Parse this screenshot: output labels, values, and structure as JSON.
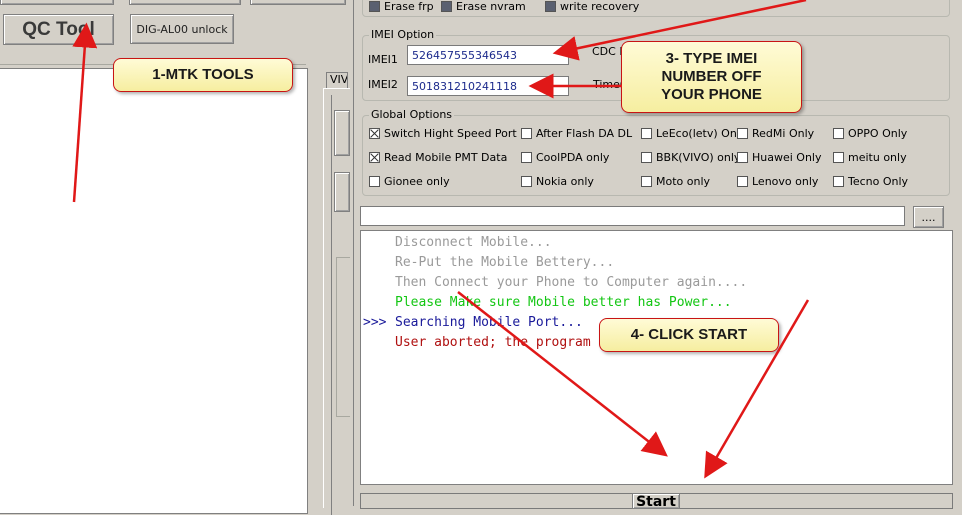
{
  "left_panel": {
    "qc_tool_label": "QC Tool",
    "dig_unlock_label": "DIG-AL00 unlock",
    "tab_partial": "VIV"
  },
  "erase_options": {
    "erase_frp": "Erase frp",
    "erase_nvram": "Erase nvram",
    "write_recovery": "write recovery"
  },
  "imei_option": {
    "group_title": "IMEI Option",
    "imei1_label": "IMEI1",
    "imei1_value": "526457555346543",
    "imei2_label": "IMEI2",
    "imei2_value": "501831210241118",
    "cdc_label_partial": "CDC F",
    "time_label_partial": "TimeC"
  },
  "global_options": {
    "group_title": "Global Options",
    "rows": [
      [
        {
          "label": "Switch Hight Speed Port",
          "checked": true
        },
        {
          "label": "After Flash DA DL",
          "checked": false
        },
        {
          "label": "LeEco(letv) Only",
          "checked": false
        },
        {
          "label": "RedMi Only",
          "checked": false
        },
        {
          "label": "OPPO Only",
          "checked": false
        }
      ],
      [
        {
          "label": "Read Mobile PMT Data",
          "checked": true
        },
        {
          "label": "CoolPDA only",
          "checked": false
        },
        {
          "label": "BBK(VIVO) only",
          "checked": false
        },
        {
          "label": "Huawei Only",
          "checked": false
        },
        {
          "label": "meitu only",
          "checked": false
        }
      ],
      [
        {
          "label": "Gionee only",
          "checked": false
        },
        {
          "label": "Nokia only",
          "checked": false
        },
        {
          "label": "Moto only",
          "checked": false
        },
        {
          "label": "Lenovo only",
          "checked": false
        },
        {
          "label": "Tecno Only",
          "checked": false
        }
      ]
    ]
  },
  "path_bar": {
    "browse_label": "...."
  },
  "log": {
    "lines": [
      {
        "prefix": "",
        "text": "Disconnect Mobile...",
        "color": "#9a9a9a"
      },
      {
        "prefix": "",
        "text": "Re-Put the Mobile Bettery...",
        "color": "#9a9a9a"
      },
      {
        "prefix": "",
        "text": "Then Connect your Phone to Computer again....",
        "color": "#9a9a9a"
      },
      {
        "prefix": "",
        "text": "Please Make sure Mobile better has Power...",
        "color": "#13c613"
      },
      {
        "prefix": ">>>",
        "text": "Searching Mobile Port...",
        "color": "#1a1a9a"
      },
      {
        "prefix": "",
        "text": "User aborted; the program",
        "color": "#b01010"
      }
    ]
  },
  "start_button": {
    "label": "Start"
  },
  "annotations": {
    "step1": "1-MTK TOOLS",
    "step3_line1": "3- TYPE IMEI",
    "step3_line2": "NUMBER OFF",
    "step3_line3": "YOUR PHONE",
    "step4": "4- CLICK START",
    "arrow_color": "#e01818"
  }
}
